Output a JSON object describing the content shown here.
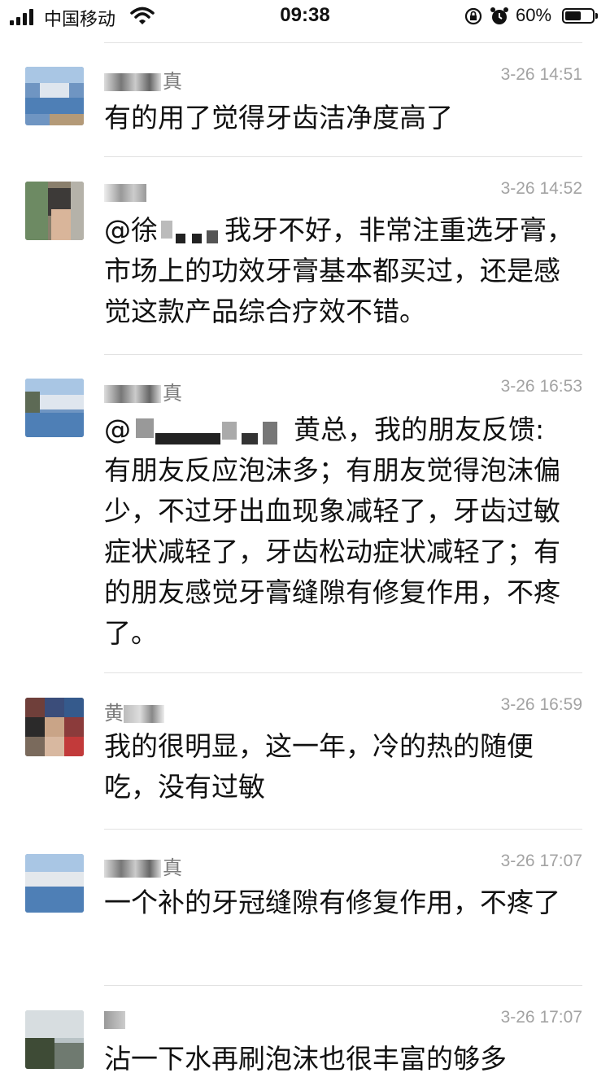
{
  "status_bar": {
    "carrier": "中国移动",
    "time": "09:38",
    "battery": "60%",
    "battery_level": 0.6,
    "icons": [
      "signal-icon",
      "wifi-icon",
      "rotation-lock-icon",
      "alarm-icon",
      "battery-icon"
    ]
  },
  "messages": [
    {
      "name": "真",
      "time": "3-26 14:51",
      "text": "有的用了觉得牙齿洁净度高了"
    },
    {
      "name": "",
      "time": "3-26 14:52",
      "mention": "@徐",
      "text": "我牙不好，非常注重选牙膏，市场上的功效牙膏基本都买过，还是感觉这款产品综合疗效不错。"
    },
    {
      "name": "真",
      "time": "3-26 16:53",
      "mention": "@",
      "mention_tail": "黄总，我的朋友反馈:",
      "text": "有朋友反应泡沫多；有朋友觉得泡沫偏少，不过牙出血现象减轻了，牙齿过敏症状减轻了，牙齿松动症状减轻了；有的朋友感觉牙膏缝隙有修复作用，不疼了。"
    },
    {
      "name": "黄",
      "time": "3-26 16:59",
      "text": "我的很明显，这一年，冷的热的随便吃，没有过敏"
    },
    {
      "name": "真",
      "time": "3-26 17:07",
      "text": "一个补的牙冠缝隙有修复作用，不疼了"
    },
    {
      "name": "",
      "time": "3-26 17:07",
      "text": "沾一下水再刷泡沫也很丰富的够多"
    }
  ]
}
